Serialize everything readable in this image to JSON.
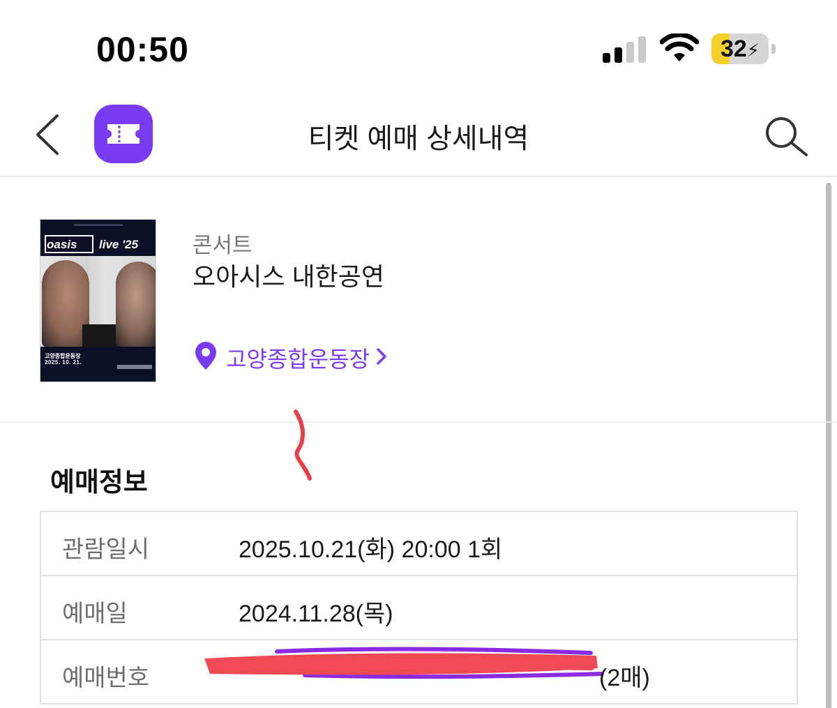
{
  "status_bar": {
    "time": "00:50",
    "battery_percent": "32",
    "battery_level": 0.32,
    "icons": [
      "signal-icon",
      "wifi-icon",
      "battery-charging-icon"
    ]
  },
  "header": {
    "title": "티켓 예매 상세내역",
    "icons": [
      "back-arrow-icon",
      "ticket-icon",
      "search-icon"
    ],
    "accent_color": "#7a3cf0"
  },
  "event": {
    "poster": {
      "brand": "oasis",
      "subtitle": "live '25",
      "venue": "고양종합운동장",
      "date": "2025. 10. 21."
    },
    "category": "콘서트",
    "title": "오아시스 내한공연",
    "venue": "고양종합운동장",
    "venue_chevron": "›"
  },
  "booking_info": {
    "section_title": "예매정보",
    "rows": [
      {
        "label": "관람일시",
        "value": "2025.10.21(화) 20:00 1회"
      },
      {
        "label": "예매일",
        "value": "2024.11.28(목)"
      },
      {
        "label": "예매번호",
        "value": "(2매)"
      }
    ]
  },
  "annotations": {
    "scribble_color": "#e8404a",
    "redaction_colors": [
      "#f04a55",
      "#8a2be2"
    ]
  }
}
